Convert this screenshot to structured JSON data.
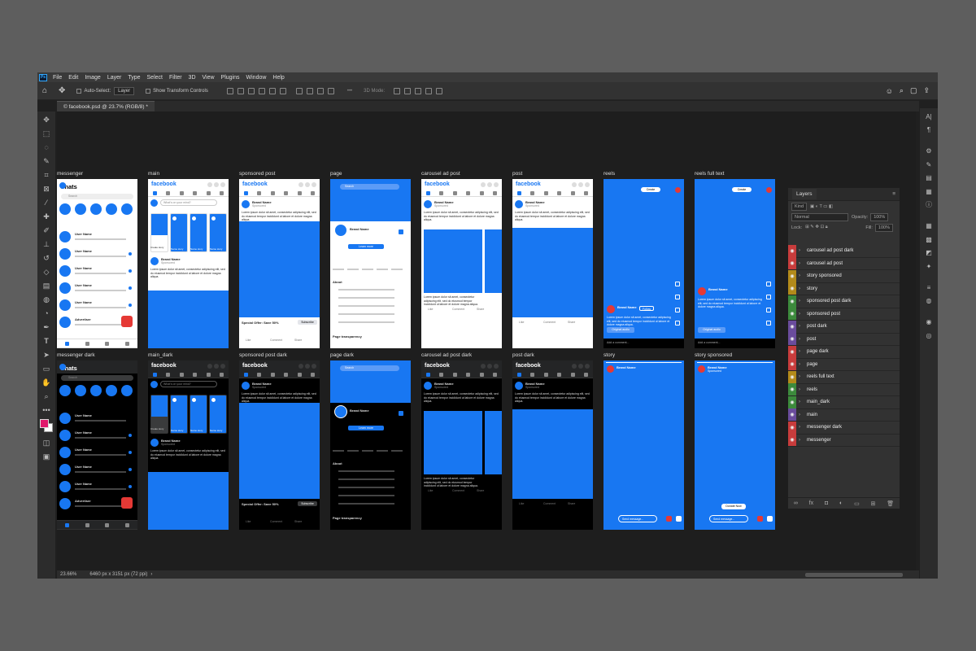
{
  "app": {
    "menu": [
      "File",
      "Edit",
      "Image",
      "Layer",
      "Type",
      "Select",
      "Filter",
      "3D",
      "View",
      "Plugins",
      "Window",
      "Help"
    ],
    "ps_badge": "Ps"
  },
  "options": {
    "auto_select": "Auto-Select:",
    "layer_select": "Layer",
    "show_transform": "Show Transform Controls",
    "mode_3d": "3D Mode:"
  },
  "document": {
    "tab": "© facebook.psd @ 23.7% (RGB/8) *",
    "zoom": "23.66%",
    "info": "6460 px x 3151 px (72 ppi)"
  },
  "artboards_top": [
    "messenger",
    "main",
    "sponsored post",
    "page",
    "carousel ad post",
    "post",
    "reels",
    "reels full text"
  ],
  "artboards_bottom": [
    "messenger dark",
    "main_dark",
    "sponsored post dark",
    "page dark",
    "carousel ad post dark",
    "post dark",
    "story",
    "story sponsored"
  ],
  "mock": {
    "chats": "Chats",
    "facebook": "facebook",
    "search": "Search",
    "user_name": "User Name",
    "brand_name": "Brand Name",
    "sponsored": "Sponsored",
    "whats_on": "What's on your mind?",
    "create_story": "Create story",
    "name_story": "Name story",
    "lorem": "Lorem ipsum dolor sit amet, consectetur adipiscing elit, sed do eiusmod tempor incididunt ut labore et dolore magna aliqua.",
    "special_offer": "Special Offer: Save 50%",
    "subscribe": "Subscribe",
    "learn_more": "Learn more",
    "like": "Like",
    "comment": "Comment",
    "share": "Share",
    "about": "About",
    "follow": "Follow",
    "original_audio": "Original audio",
    "add_comment": "Add a comment...",
    "send_message": "Send message...",
    "donate_now": "Donate Now",
    "page_transparency": "Page transparency",
    "create": "Create",
    "advertiser": "Advertiser"
  },
  "layers": {
    "title": "Layers",
    "kind": "Kind",
    "normal": "Normal",
    "opacity_label": "Opacity:",
    "opacity": "100%",
    "lock": "Lock:",
    "fill_label": "Fill:",
    "fill": "100%",
    "items": [
      {
        "name": "carousel ad post dark",
        "color": "#c83c3c"
      },
      {
        "name": "carousel ad post",
        "color": "#c83c3c"
      },
      {
        "name": "story sponsored",
        "color": "#b38a1a"
      },
      {
        "name": "story",
        "color": "#b38a1a"
      },
      {
        "name": "sponsored post dark",
        "color": "#3c8a3c"
      },
      {
        "name": "sponsored post",
        "color": "#3c8a3c"
      },
      {
        "name": "post dark",
        "color": "#6a4c9c"
      },
      {
        "name": "post",
        "color": "#6a4c9c"
      },
      {
        "name": "page dark",
        "color": "#c83c3c"
      },
      {
        "name": "page",
        "color": "#c83c3c"
      },
      {
        "name": "reels full text",
        "color": "#b38a1a"
      },
      {
        "name": "reels",
        "color": "#3c8a3c"
      },
      {
        "name": "main_dark",
        "color": "#3c8a3c"
      },
      {
        "name": "main",
        "color": "#6a4c9c"
      },
      {
        "name": "messenger dark",
        "color": "#c83c3c"
      },
      {
        "name": "messenger",
        "color": "#c83c3c"
      }
    ]
  }
}
